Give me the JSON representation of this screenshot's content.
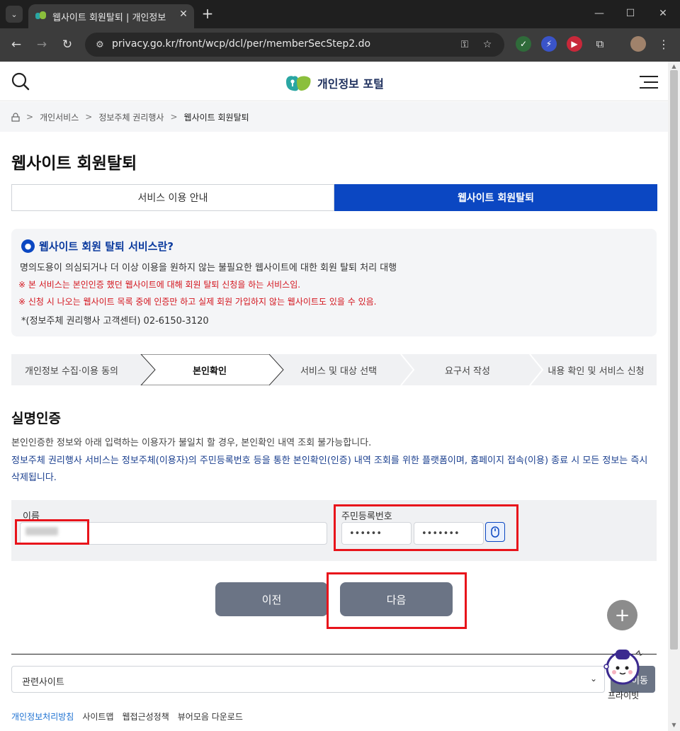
{
  "browser": {
    "tab_title": "웹사이트 회원탈퇴 | 개인정보",
    "url": "privacy.go.kr/front/wcp/dcl/per/memberSecStep2.do",
    "icons": [
      "tab-list-icon",
      "close-icon",
      "new-tab-icon",
      "minimize-icon",
      "maximize-icon",
      "window-close-icon",
      "back-icon",
      "forward-icon",
      "reload-icon",
      "site-settings-icon",
      "password-key-icon",
      "bookmark-star-icon",
      "extensions-icon",
      "profile-avatar",
      "more-menu-icon"
    ]
  },
  "header": {
    "logo_text": "개인정보 포털"
  },
  "breadcrumb": {
    "items": [
      "개인서비스",
      "정보주체 권리행사",
      "웹사이트 회원탈퇴"
    ]
  },
  "page": {
    "title": "웹사이트 회원탈퇴"
  },
  "tabs": [
    {
      "label": "서비스 이용 안내",
      "active": false
    },
    {
      "label": "웹사이트 회원탈퇴",
      "active": true
    }
  ],
  "info": {
    "title": "웹사이트 회원 탈퇴 서비스란?",
    "description": "명의도용이 의심되거나 더 이상 이용을 원하지 않는 불필요한 웹사이트에 대한 회원 탈퇴 처리 대행",
    "warning1": "※ 본 서비스는 본인인증 했던 웹사이트에 대해 회원 탈퇴 신청을 하는 서비스임.",
    "warning2": "※ 신청 시 나오는 웹사이트 목록 중에 인증만 하고 실제 회원 가입하지 않는 웹사이트도 있을 수 있음.",
    "contact": "*(정보주체 권리행사 고객센터) 02-6150-3120"
  },
  "steps": [
    {
      "label": "개인정보 수집·이용 동의",
      "active": false
    },
    {
      "label": "본인확인",
      "active": true
    },
    {
      "label": "서비스 및 대상 선택",
      "active": false
    },
    {
      "label": "요구서 작성",
      "active": false
    },
    {
      "label": "내용 확인 및 서비스 신청",
      "active": false
    }
  ],
  "section": {
    "title": "실명인증",
    "desc1": "본인인증한 정보와 아래 입력하는 이용자가 불일치 할 경우, 본인확인 내역 조회 불가능합니다.",
    "desc2": "정보주체 권리행사 서비스는 정보주체(이용자)의 주민등록번호 등을 통한 본인확인(인증) 내역 조회를 위한 플랫폼이며, 홈페이지 접속(이용) 종료 시 모든 정보는 즉시 삭제됩니다."
  },
  "form": {
    "name_label": "이름",
    "name_value": "",
    "rrn_label": "주민등록번호",
    "rrn_front": "••••••",
    "rrn_back": "•••••••"
  },
  "buttons": {
    "prev": "이전",
    "next": "다음",
    "plus": "+"
  },
  "footer": {
    "related_sites": "관련사이트",
    "go": "이동",
    "mascot_label": "프라이빗",
    "links": [
      "개인정보처리방침",
      "사이트맵",
      "웹접근성정책",
      "뷰어모음 다운로드"
    ]
  },
  "colors": {
    "primary": "#0b47c2",
    "warning": "#d3141d",
    "highlight": "#e8141b",
    "button": "#6b7485"
  }
}
